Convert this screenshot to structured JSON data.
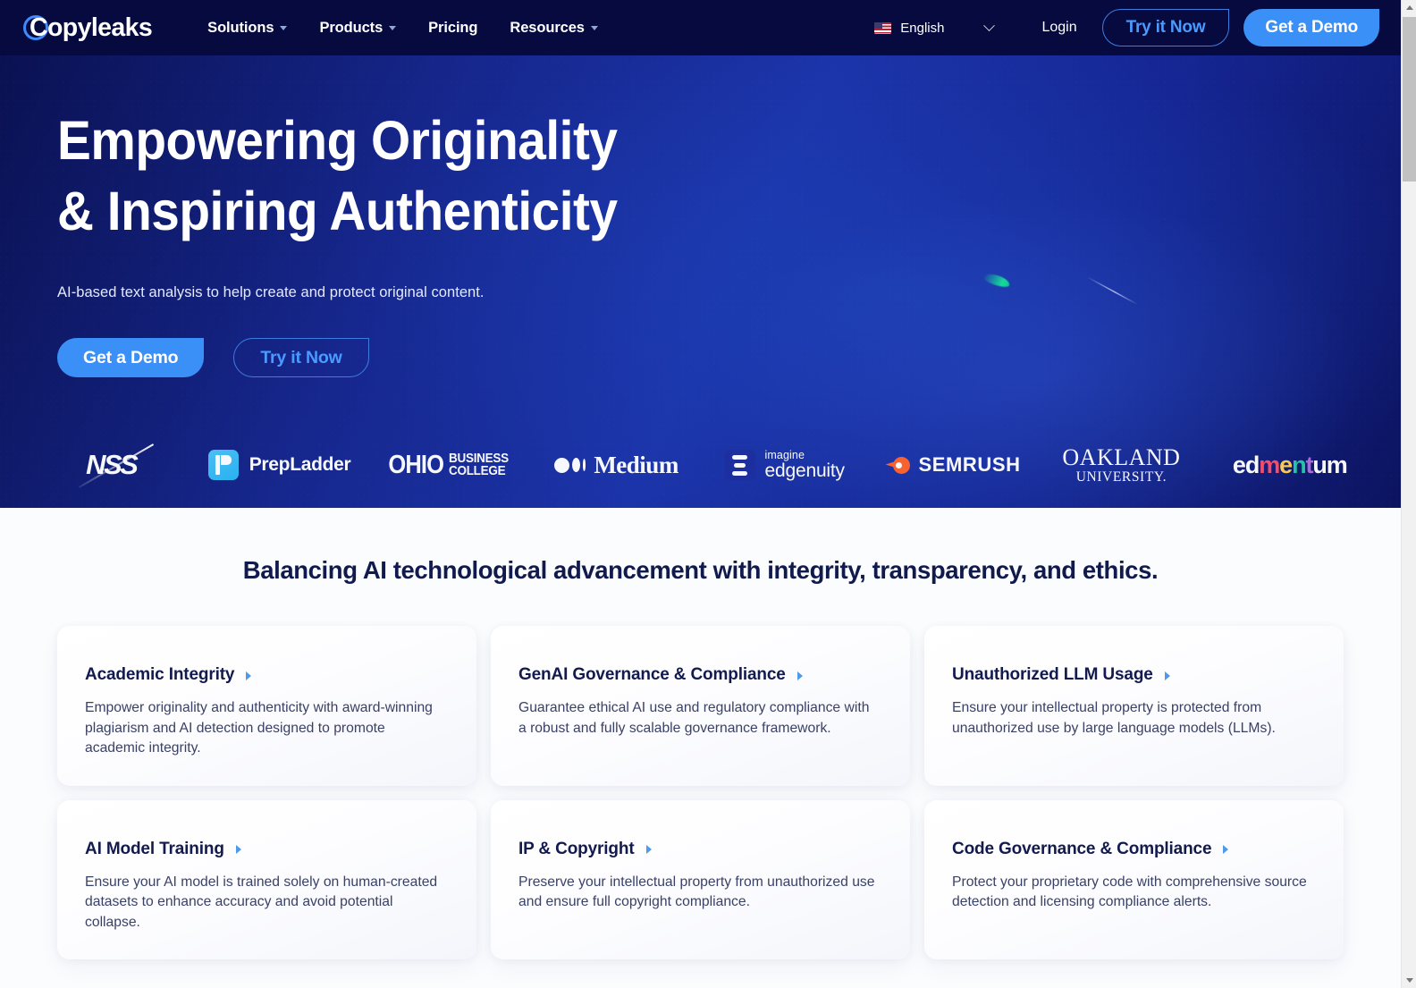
{
  "brand": {
    "name": "Copyleaks",
    "logo_icon": "copyleaks-logo-icon"
  },
  "nav": {
    "links": [
      {
        "label": "Solutions",
        "has_dropdown": true
      },
      {
        "label": "Products",
        "has_dropdown": true
      },
      {
        "label": "Pricing",
        "has_dropdown": false
      },
      {
        "label": "Resources",
        "has_dropdown": true
      }
    ],
    "language": {
      "label": "English",
      "flag_icon": "us-flag-icon",
      "chevron_icon": "chevron-down-icon"
    },
    "login_label": "Login",
    "try_label": "Try it Now",
    "demo_label": "Get a Demo"
  },
  "hero": {
    "title_line1": "Empowering Originality",
    "title_line2": "& Inspiring Authenticity",
    "subtitle": "AI-based text analysis to help create and protect original content.",
    "primary_cta": "Get a Demo",
    "secondary_cta": "Try it Now"
  },
  "logos": [
    {
      "name": "NSS",
      "icon": "nss-logo"
    },
    {
      "name": "PrepLadder",
      "icon": "prepladder-logo"
    },
    {
      "name": "OHIO",
      "sub_line1": "BUSINESS",
      "sub_line2": "COLLEGE",
      "icon": "ohio-business-college-logo"
    },
    {
      "name": "Medium",
      "icon": "medium-logo"
    },
    {
      "name": "imagine",
      "sub": "edgenuity",
      "icon": "imagine-edgenuity-logo"
    },
    {
      "name": "SEMRUSH",
      "icon": "semrush-logo"
    },
    {
      "name": "OAKLAND",
      "sub": "UNIVERSITY.",
      "icon": "oakland-university-logo"
    },
    {
      "name": "edmentum",
      "icon": "edmentum-logo"
    }
  ],
  "features": {
    "heading": "Balancing AI technological advancement with integrity, transparency, and ethics.",
    "cards": [
      {
        "title": "Academic Integrity",
        "desc": "Empower originality and authenticity with award-winning plagiarism and AI detection designed to promote academic integrity."
      },
      {
        "title": "GenAI Governance & Compliance",
        "desc": "Guarantee ethical AI use and regulatory compliance with a robust and fully scalable governance framework."
      },
      {
        "title": "Unauthorized LLM Usage",
        "desc": "Ensure your intellectual property is protected from unauthorized use by large language models (LLMs)."
      },
      {
        "title": "AI Model Training",
        "desc": "Ensure your AI model is trained solely on human-created datasets to enhance accuracy and avoid potential collapse."
      },
      {
        "title": "IP & Copyright",
        "desc": "Preserve your intellectual property from unauthorized use and ensure full copyright compliance."
      },
      {
        "title": "Code Governance & Compliance",
        "desc": "Protect your proprietary code with comprehensive source detection and licensing compliance alerts."
      }
    ]
  },
  "colors": {
    "nav_bg": "#060a3f",
    "hero_blue": "#1b33a8",
    "accent_blue": "#3b90f7",
    "outline_blue": "#4a9bff",
    "title_navy": "#121a4e",
    "body_text": "#3a4166",
    "card_arrow": "#4e9ae8",
    "comet_green": "#16e39a"
  }
}
